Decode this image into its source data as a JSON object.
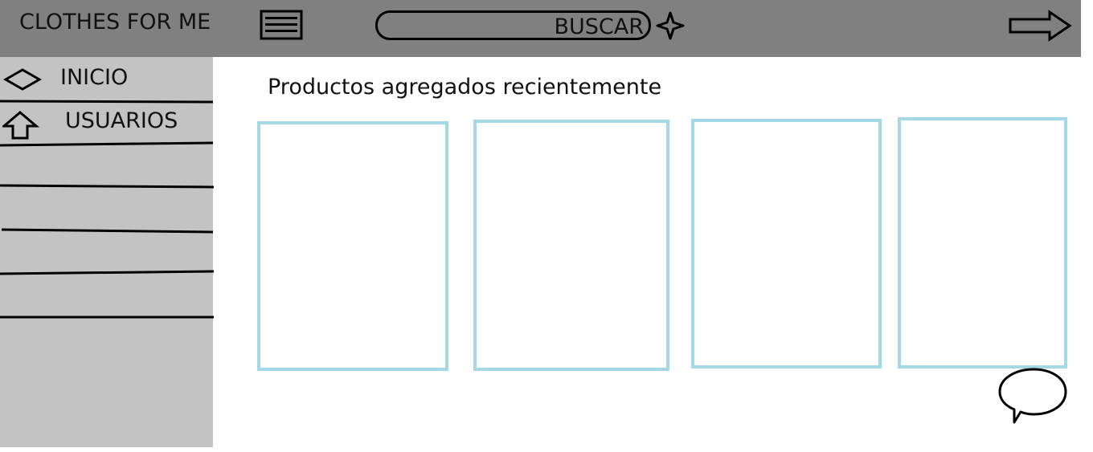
{
  "header": {
    "brand": "CLOTHES FOR ME",
    "search_label": "BUSCAR",
    "icons": {
      "menu": "menu-icon",
      "sparkle": "sparkle-icon",
      "logout": "arrow-right-icon"
    }
  },
  "sidebar": {
    "items": [
      {
        "label": "INICIO",
        "icon": "diamond-icon"
      },
      {
        "label": "USUARIOS",
        "icon": "arrow-up-icon"
      }
    ],
    "empty_slots": 4
  },
  "main": {
    "title": "Productos agregados recientemente",
    "cards": [
      {},
      {},
      {},
      {}
    ]
  },
  "colors": {
    "header_bg": "#808080",
    "sidebar_bg": "#c3c3c3",
    "card_border": "#a5d8e6"
  }
}
